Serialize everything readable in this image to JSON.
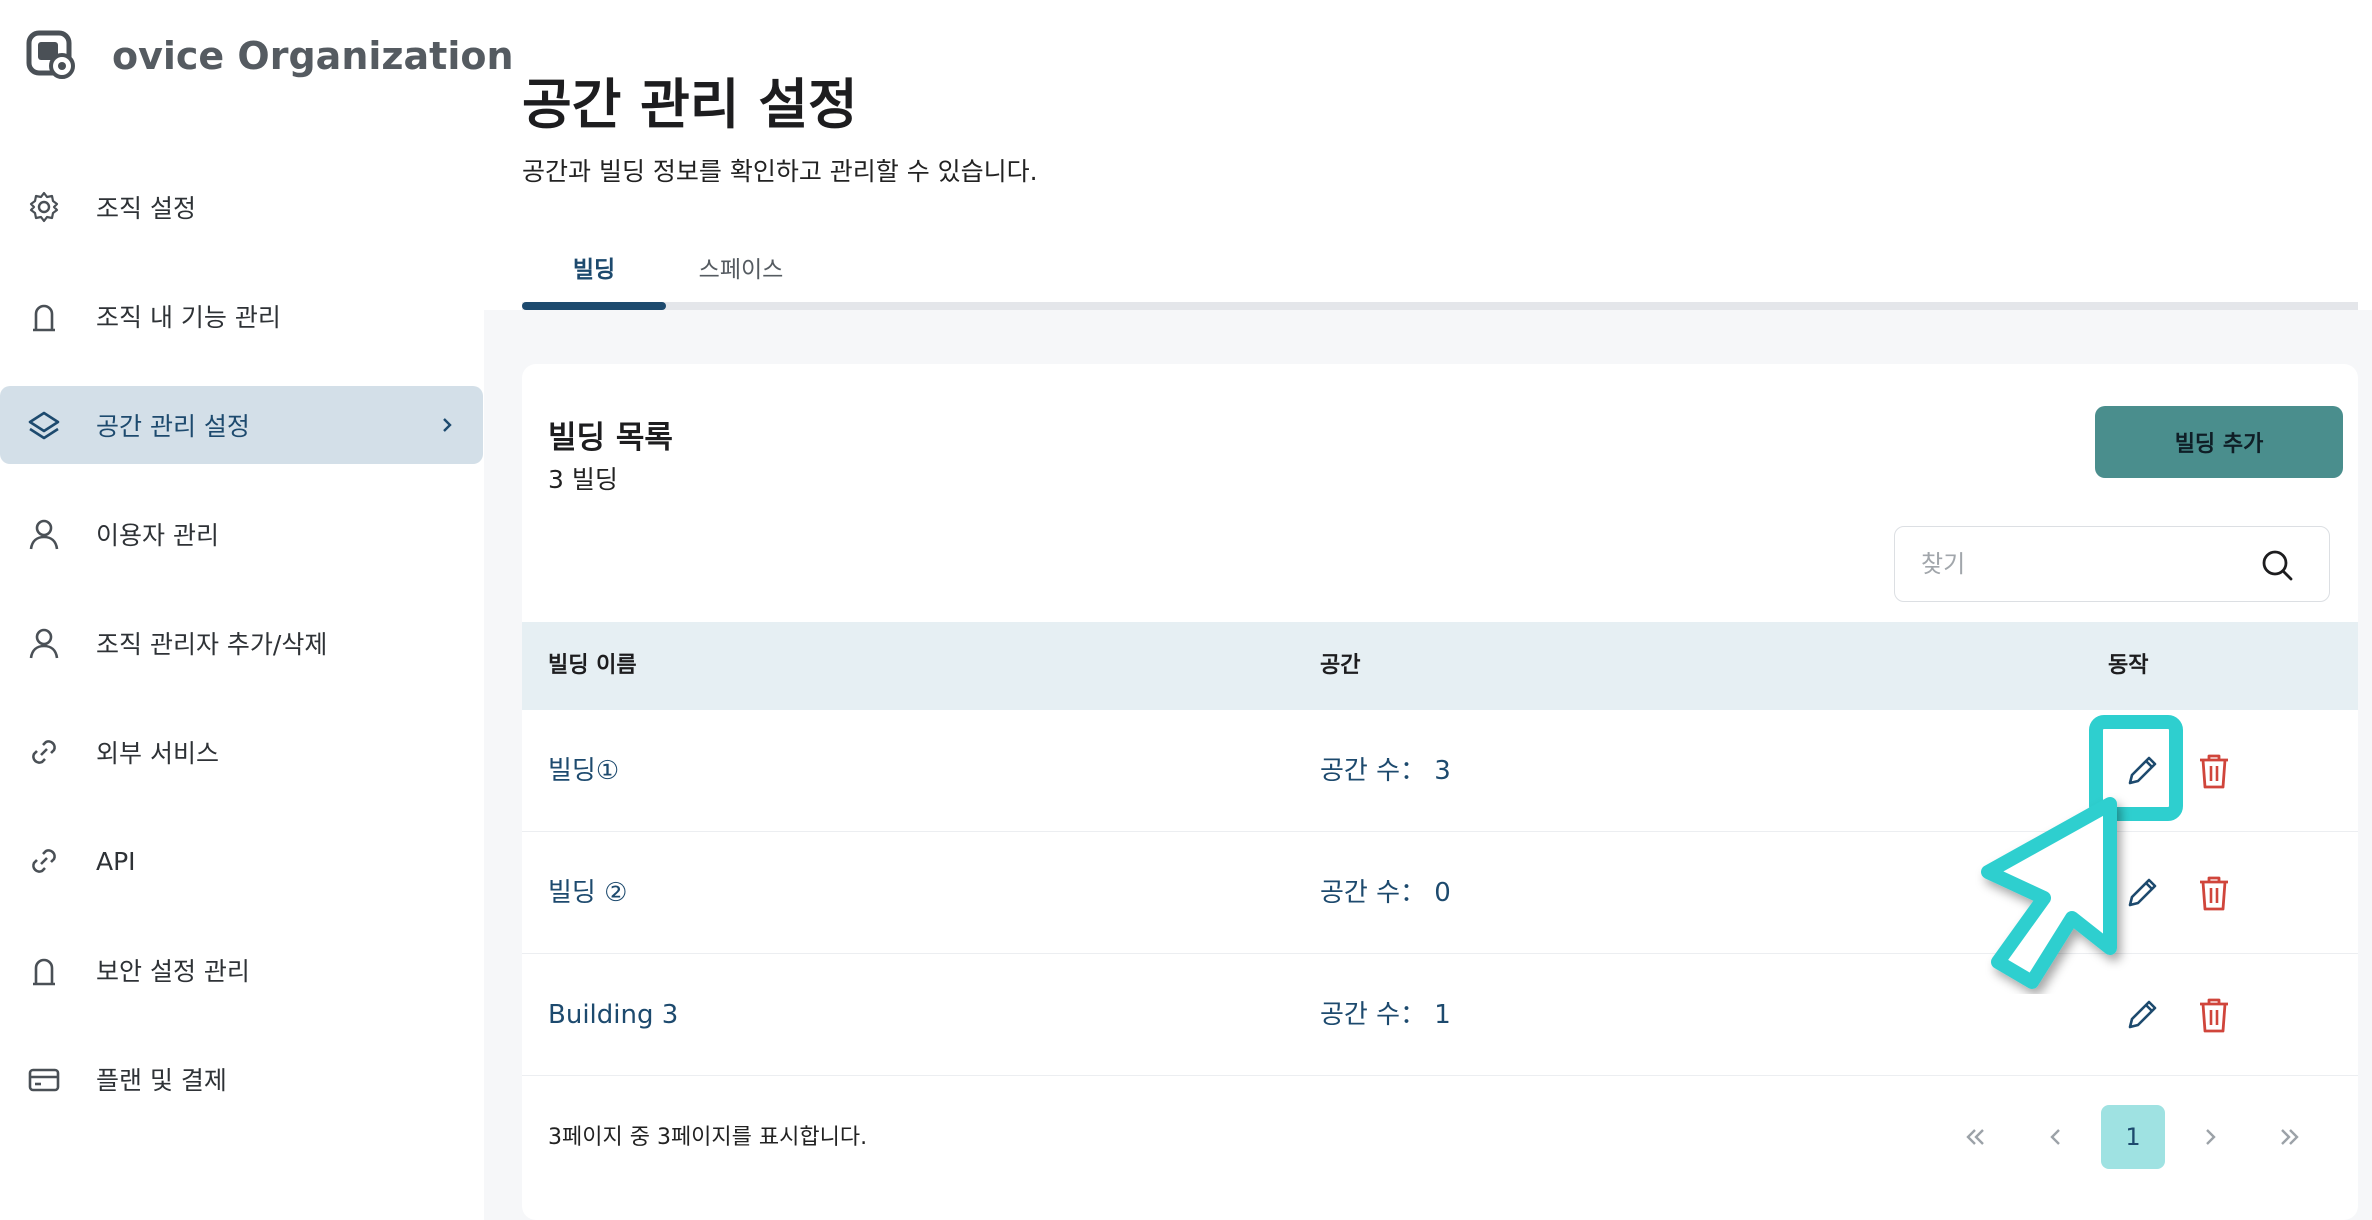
{
  "org": {
    "name": "ovice Organization"
  },
  "nav": {
    "items": [
      {
        "label": "조직 설정",
        "icon": "gear-icon"
      },
      {
        "label": "조직 내 기능 관리",
        "icon": "lock-icon"
      },
      {
        "label": "공간 관리 설정",
        "icon": "layers-icon",
        "active": true
      },
      {
        "label": "이용자 관리",
        "icon": "user-icon"
      },
      {
        "label": "조직 관리자 추가/삭제",
        "icon": "user-icon"
      },
      {
        "label": "외부 서비스",
        "icon": "link-icon"
      },
      {
        "label": "API",
        "icon": "link-icon"
      },
      {
        "label": "보안 설정 관리",
        "icon": "lock-icon"
      },
      {
        "label": "플랜 및 결제",
        "icon": "credit-card-icon"
      }
    ]
  },
  "page": {
    "title": "공간 관리 설정",
    "subtitle": "공간과 빌딩 정보를 확인하고 관리할 수 있습니다."
  },
  "tabs": [
    {
      "label": "빌딩",
      "active": true
    },
    {
      "label": "스페이스",
      "active": false
    }
  ],
  "card": {
    "title": "빌딩 목록",
    "count": "3 빌딩",
    "add_button": "빌딩 추가",
    "search_placeholder": "찾기"
  },
  "table": {
    "headers": {
      "name": "빌딩 이름",
      "space": "공간",
      "action": "동작"
    },
    "rows": [
      {
        "name": "빌딩①",
        "space": "공간 수： 3"
      },
      {
        "name": "빌딩 ②",
        "space": "공간 수： 0"
      },
      {
        "name": "Building 3",
        "space": "공간 수： 1"
      }
    ]
  },
  "pagination": {
    "info": "3페이지 중 3페이지를 표시합니다.",
    "current": "1"
  },
  "colors": {
    "accent": "#1d4a6e",
    "primary_button": "#4a8e8d",
    "delete": "#d0453b",
    "highlight": "#2ecfcf",
    "active_nav": "#d3dfe8"
  }
}
